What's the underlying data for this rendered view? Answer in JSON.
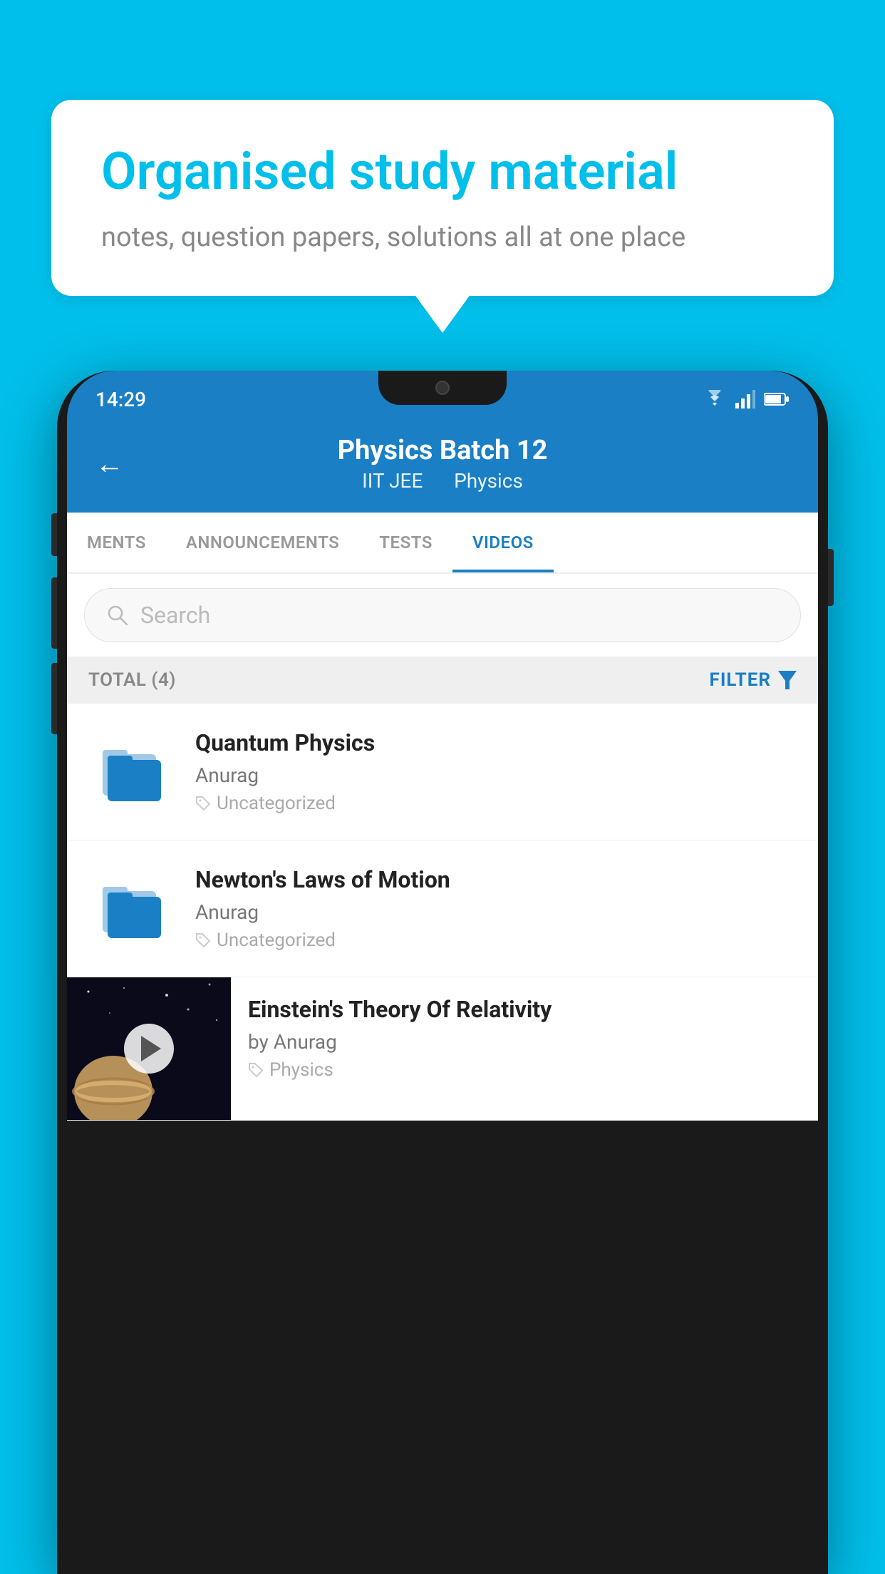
{
  "app": {
    "background_color": "#00BFEA"
  },
  "speech_bubble": {
    "heading": "Organised study material",
    "subtext": "notes, question papers, solutions all at one place"
  },
  "status_bar": {
    "time": "14:29",
    "wifi_icon": "wifi",
    "signal_icon": "signal",
    "battery_icon": "battery"
  },
  "app_header": {
    "back_label": "←",
    "title": "Physics Batch 12",
    "subtitle_part1": "IIT JEE",
    "subtitle_part2": "Physics"
  },
  "tabs": [
    {
      "label": "MENTS",
      "active": false
    },
    {
      "label": "ANNOUNCEMENTS",
      "active": false
    },
    {
      "label": "TESTS",
      "active": false
    },
    {
      "label": "VIDEOS",
      "active": true
    }
  ],
  "search": {
    "placeholder": "Search"
  },
  "filter_bar": {
    "total_label": "TOTAL (4)",
    "filter_label": "FILTER"
  },
  "videos": [
    {
      "title": "Quantum Physics",
      "author": "Anurag",
      "tag": "Uncategorized",
      "has_thumbnail": false
    },
    {
      "title": "Newton's Laws of Motion",
      "author": "Anurag",
      "tag": "Uncategorized",
      "has_thumbnail": false
    },
    {
      "title": "Einstein's Theory Of Relativity",
      "author": "by Anurag",
      "tag": "Physics",
      "has_thumbnail": true
    }
  ]
}
